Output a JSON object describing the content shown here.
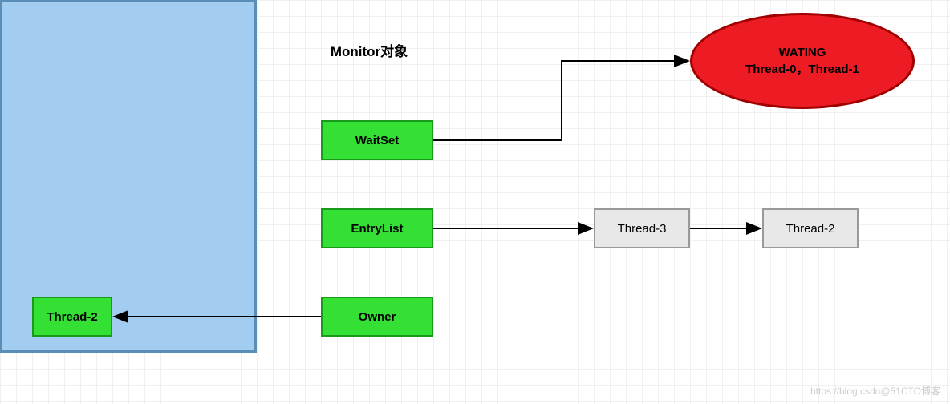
{
  "monitor": {
    "title": "Monitor对象",
    "waitset": "WaitSet",
    "entrylist": "EntryList",
    "owner": "Owner"
  },
  "threads": {
    "owner_thread": "Thread-2",
    "entry_thread_a": "Thread-3",
    "entry_thread_b": "Thread-2"
  },
  "waiting": {
    "state": "WATING",
    "list": "Thread-0，Thread-1"
  },
  "watermark": "https://blog.csdn@51CTO博客"
}
